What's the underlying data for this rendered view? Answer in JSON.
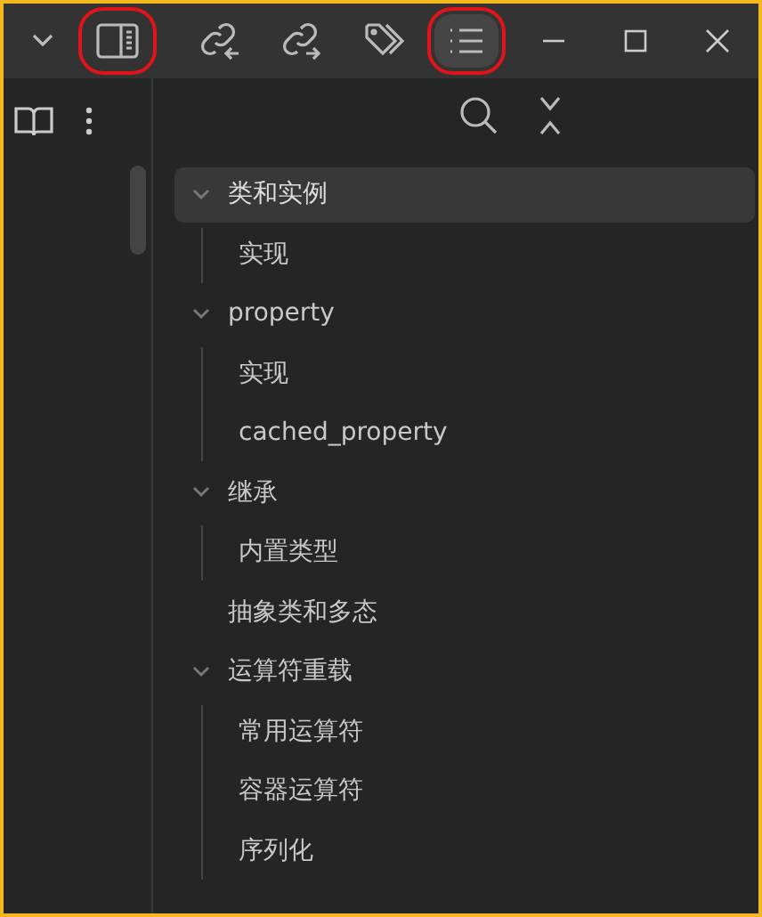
{
  "toolbar": {
    "buttons": [
      {
        "kind": "chevron",
        "selected": false,
        "highlighted": false
      },
      {
        "kind": "sidebar",
        "selected": false,
        "highlighted": true
      },
      {
        "kind": "backlinks",
        "selected": false,
        "highlighted": false
      },
      {
        "kind": "outlinks",
        "selected": false,
        "highlighted": false
      },
      {
        "kind": "tags",
        "selected": false,
        "highlighted": false
      },
      {
        "kind": "outline",
        "selected": true,
        "highlighted": true
      }
    ],
    "window_controls": [
      {
        "kind": "minimize"
      },
      {
        "kind": "maximize"
      },
      {
        "kind": "close"
      }
    ]
  },
  "outline": {
    "items": [
      {
        "text": "类和实例",
        "selected": true,
        "expanded": true,
        "children": [
          {
            "text": "实现",
            "selected": false
          }
        ]
      },
      {
        "text": "property",
        "selected": false,
        "expanded": true,
        "children": [
          {
            "text": "实现",
            "selected": false
          },
          {
            "text": "cached_property",
            "selected": false
          }
        ]
      },
      {
        "text": "继承",
        "selected": false,
        "expanded": true,
        "children": [
          {
            "text": "内置类型",
            "selected": false
          }
        ]
      },
      {
        "text": "抽象类和多态",
        "selected": false
      },
      {
        "text": "运算符重载",
        "selected": false,
        "expanded": true,
        "children": [
          {
            "text": "常用运算符",
            "selected": false
          },
          {
            "text": "容器运算符",
            "selected": false
          },
          {
            "text": "序列化",
            "selected": false
          }
        ]
      }
    ]
  }
}
